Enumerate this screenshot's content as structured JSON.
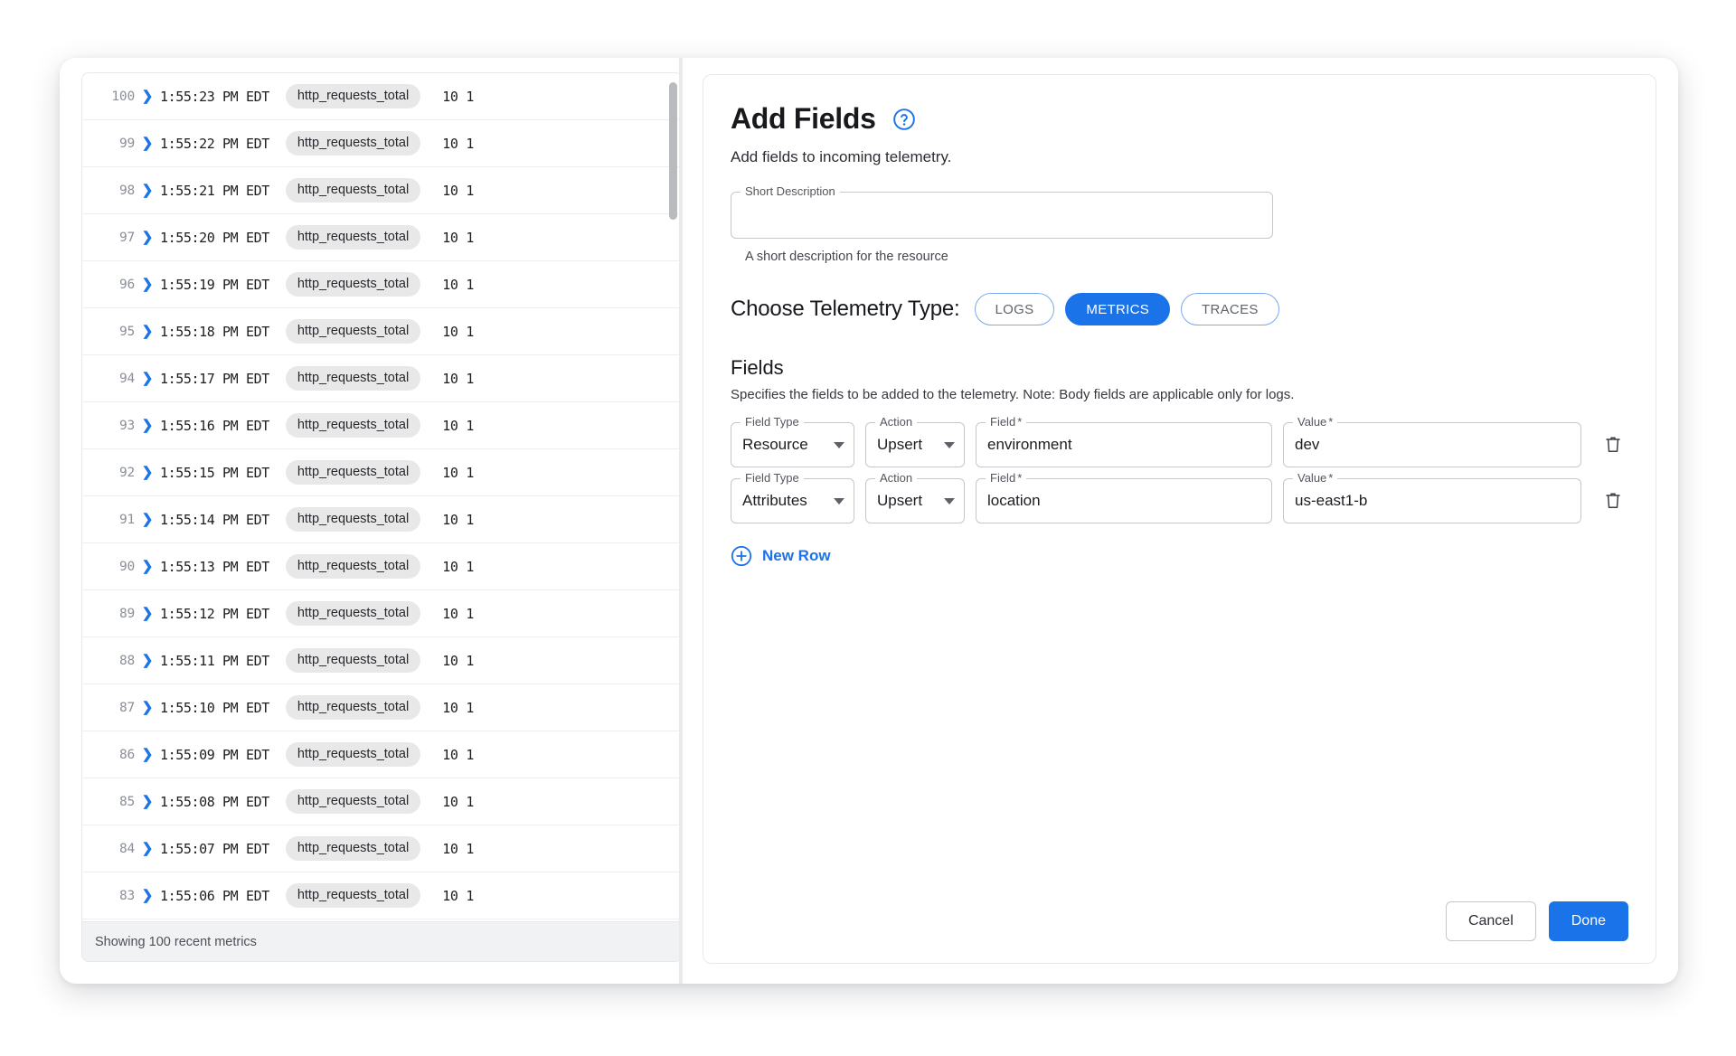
{
  "left_panel": {
    "status_text": "Showing 100 recent metrics",
    "columns": [
      "index",
      "expand",
      "timestamp",
      "metric_name",
      "values"
    ],
    "rows": [
      {
        "index": "100",
        "time": "1:55:23 PM EDT",
        "name": "http_requests_total",
        "values": "10 1"
      },
      {
        "index": "99",
        "time": "1:55:22 PM EDT",
        "name": "http_requests_total",
        "values": "10 1"
      },
      {
        "index": "98",
        "time": "1:55:21 PM EDT",
        "name": "http_requests_total",
        "values": "10 1"
      },
      {
        "index": "97",
        "time": "1:55:20 PM EDT",
        "name": "http_requests_total",
        "values": "10 1"
      },
      {
        "index": "96",
        "time": "1:55:19 PM EDT",
        "name": "http_requests_total",
        "values": "10 1"
      },
      {
        "index": "95",
        "time": "1:55:18 PM EDT",
        "name": "http_requests_total",
        "values": "10 1"
      },
      {
        "index": "94",
        "time": "1:55:17 PM EDT",
        "name": "http_requests_total",
        "values": "10 1"
      },
      {
        "index": "93",
        "time": "1:55:16 PM EDT",
        "name": "http_requests_total",
        "values": "10 1"
      },
      {
        "index": "92",
        "time": "1:55:15 PM EDT",
        "name": "http_requests_total",
        "values": "10 1"
      },
      {
        "index": "91",
        "time": "1:55:14 PM EDT",
        "name": "http_requests_total",
        "values": "10 1"
      },
      {
        "index": "90",
        "time": "1:55:13 PM EDT",
        "name": "http_requests_total",
        "values": "10 1"
      },
      {
        "index": "89",
        "time": "1:55:12 PM EDT",
        "name": "http_requests_total",
        "values": "10 1"
      },
      {
        "index": "88",
        "time": "1:55:11 PM EDT",
        "name": "http_requests_total",
        "values": "10 1"
      },
      {
        "index": "87",
        "time": "1:55:10 PM EDT",
        "name": "http_requests_total",
        "values": "10 1"
      },
      {
        "index": "86",
        "time": "1:55:09 PM EDT",
        "name": "http_requests_total",
        "values": "10 1"
      },
      {
        "index": "85",
        "time": "1:55:08 PM EDT",
        "name": "http_requests_total",
        "values": "10 1"
      },
      {
        "index": "84",
        "time": "1:55:07 PM EDT",
        "name": "http_requests_total",
        "values": "10 1"
      },
      {
        "index": "83",
        "time": "1:55:06 PM EDT",
        "name": "http_requests_total",
        "values": "10 1"
      }
    ]
  },
  "dialog": {
    "title": "Add Fields",
    "help_icon": "help-circle-icon",
    "subtitle": "Add fields to incoming telemetry.",
    "short_description": {
      "label": "Short Description",
      "value": "",
      "placeholder": "",
      "helper": "A short description for the resource"
    },
    "telemetry": {
      "label": "Choose Telemetry Type:",
      "options": [
        {
          "label": "LOGS",
          "selected": false
        },
        {
          "label": "METRICS",
          "selected": true
        },
        {
          "label": "TRACES",
          "selected": false
        }
      ]
    },
    "fields_section": {
      "title": "Fields",
      "description": "Specifies the fields to be added to the telemetry. Note: Body fields are applicable only for logs.",
      "labels": {
        "field_type": "Field Type",
        "action": "Action",
        "field": "Field",
        "value": "Value",
        "required_mark": "*"
      },
      "rows": [
        {
          "field_type": "Resource",
          "action": "Upsert",
          "field": "environment",
          "value": "dev",
          "delete_icon": "trash-icon"
        },
        {
          "field_type": "Attributes",
          "action": "Upsert",
          "field": "location",
          "value": "us-east1-b",
          "delete_icon": "trash-icon"
        }
      ],
      "new_row_label": "New Row"
    },
    "footer": {
      "cancel_label": "Cancel",
      "done_label": "Done"
    }
  },
  "colors": {
    "accent": "#1a73e8",
    "chip_border": "#7aa9f0",
    "text": "#17191d",
    "muted": "#8a8f98",
    "tag_bg": "#e8e8e8",
    "status_bg": "#f1f2f4"
  }
}
